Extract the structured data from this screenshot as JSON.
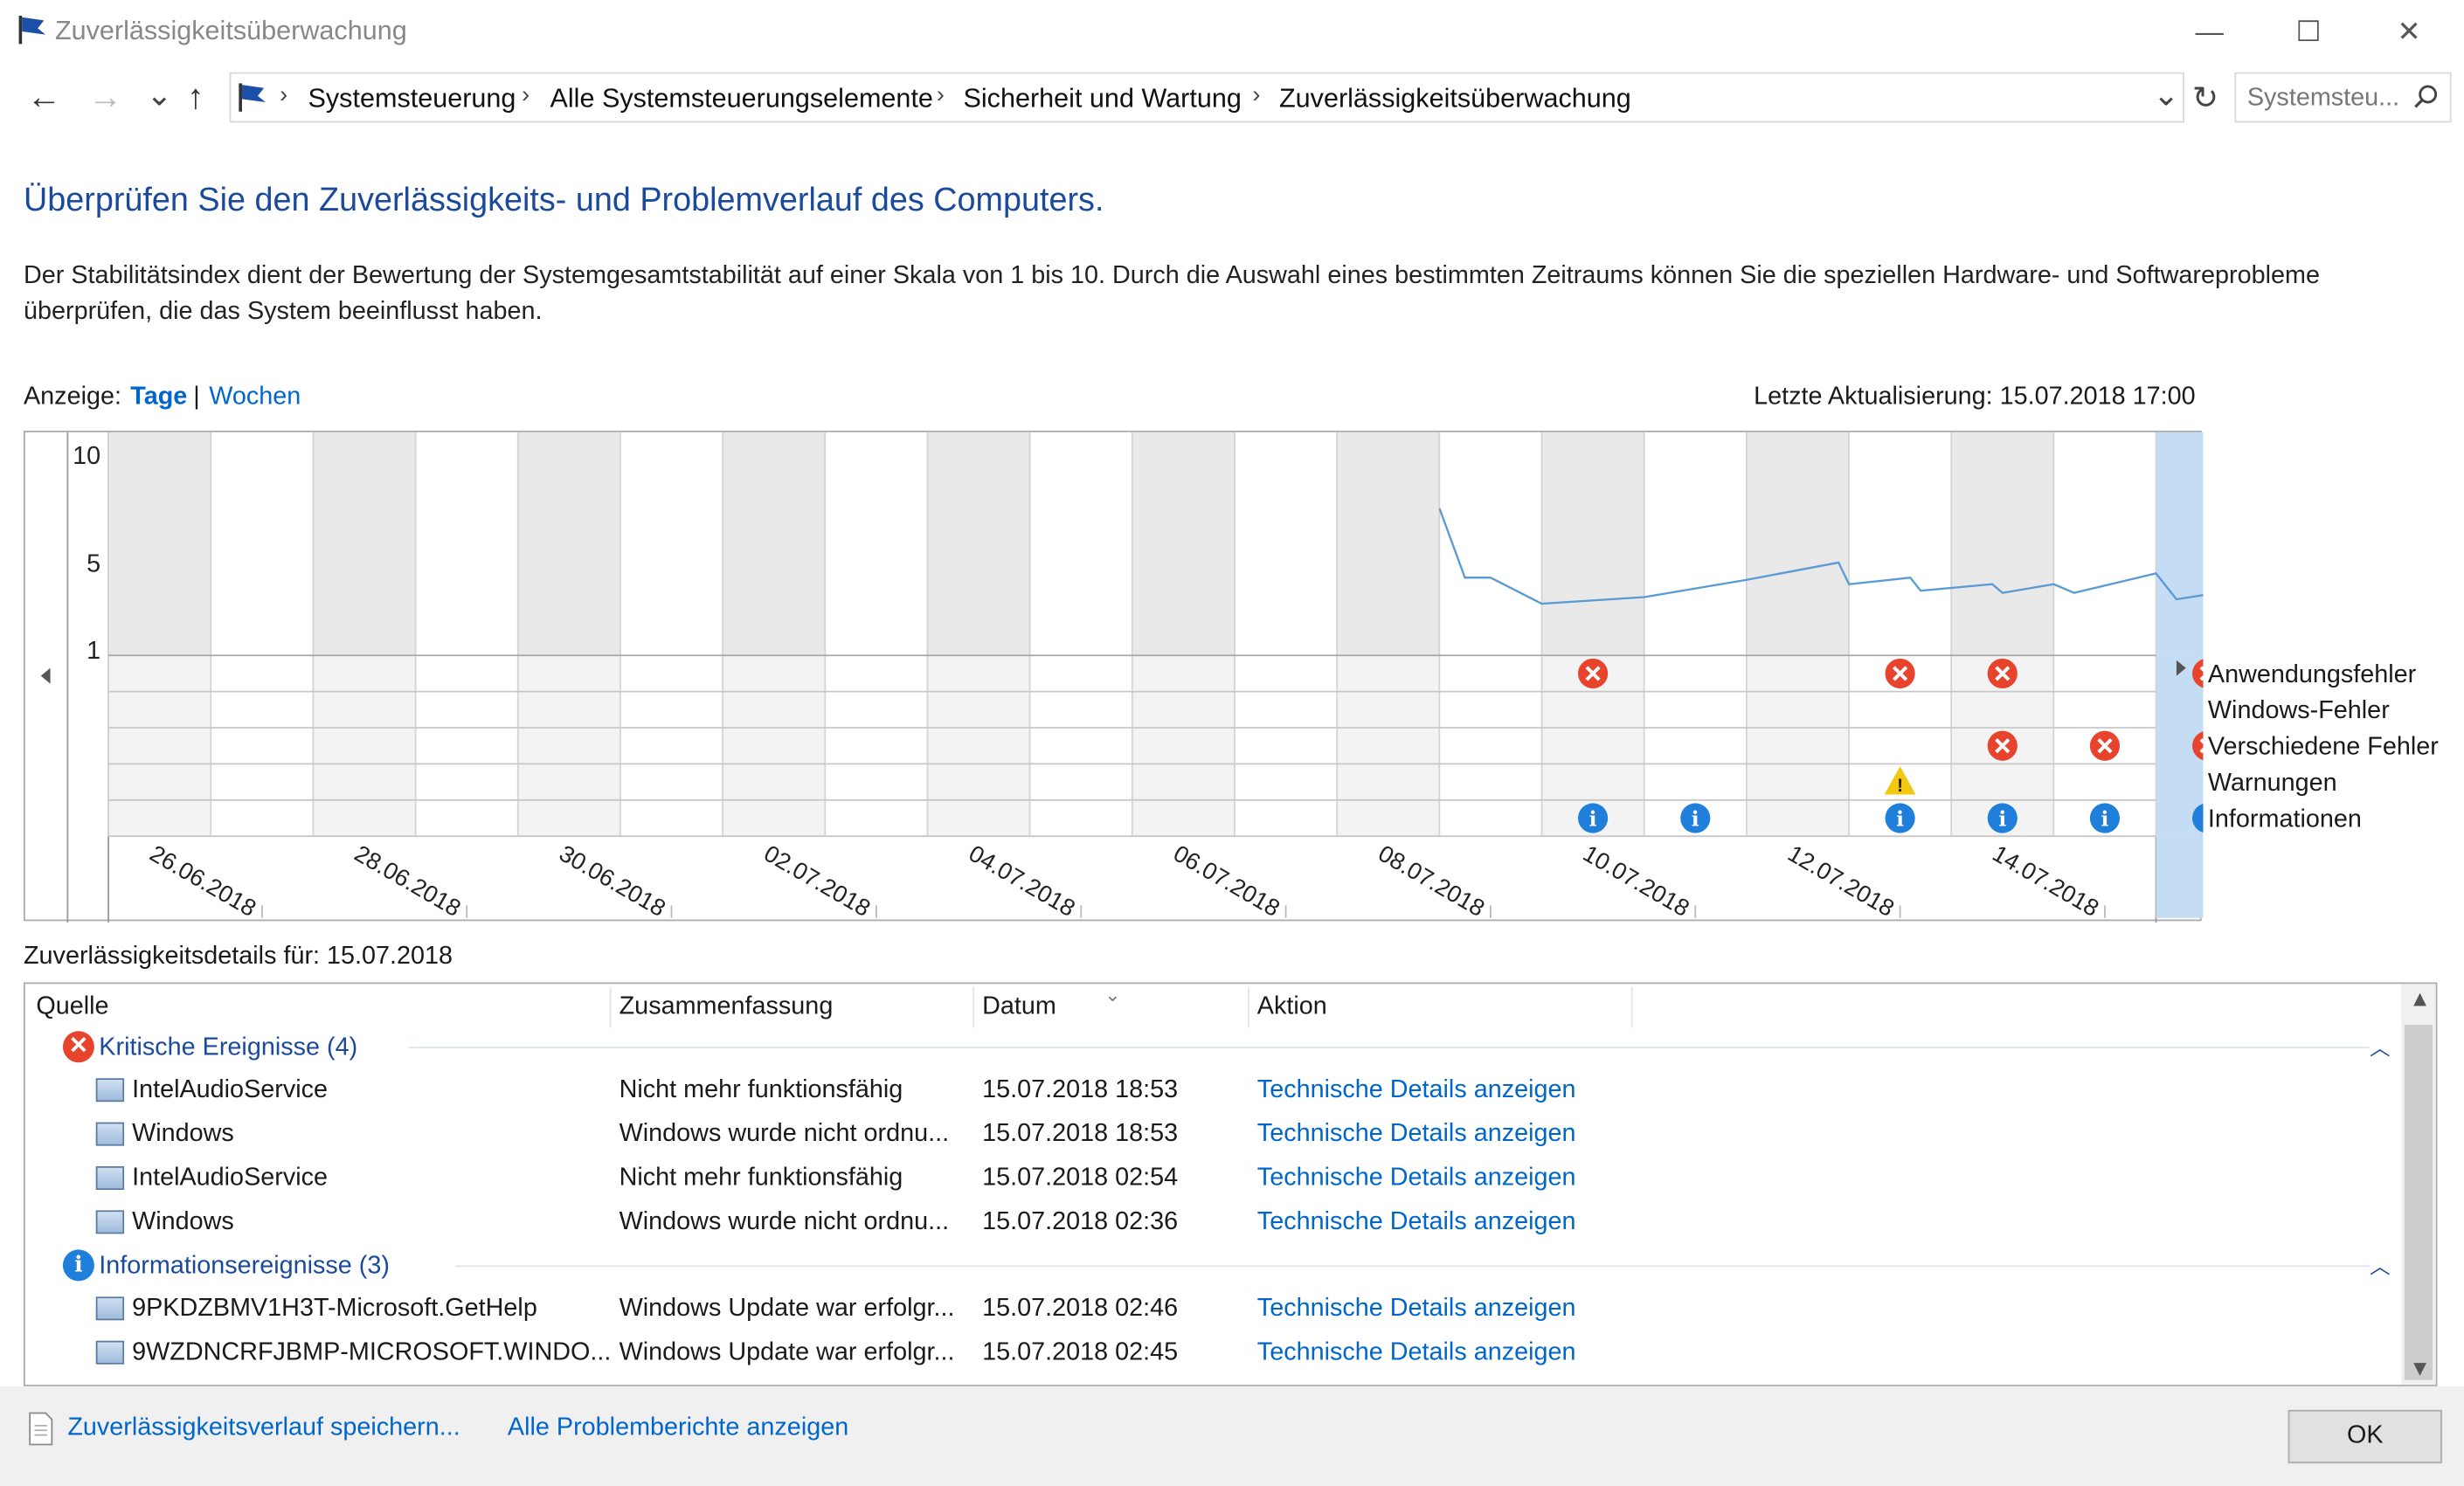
{
  "window": {
    "title": "Zuverlässigkeitsüberwachung",
    "minimize": "—",
    "maximize": "☐",
    "close": "✕"
  },
  "nav": {
    "back": "←",
    "forward": "→",
    "recent": "⌄",
    "up": "↑",
    "refresh": "↻",
    "dropdown": "⌄"
  },
  "breadcrumb": [
    "Systemsteuerung",
    "Alle Systemsteuerungselemente",
    "Sicherheit und Wartung",
    "Zuverlässigkeitsüberwachung"
  ],
  "search": {
    "placeholder": "Systemsteu...",
    "icon": "search-icon"
  },
  "heading": "Überprüfen Sie den Zuverlässigkeits- und Problemverlauf des Computers.",
  "description": "Der Stabilitätsindex dient der Bewertung der Systemgesamtstabilität auf einer Skala von 1 bis 10. Durch die Auswahl eines bestimmten Zeitraums können Sie die speziellen Hardware- und Softwareprobleme überprüfen, die das System beeinflusst haben.",
  "view": {
    "label": "Anzeige:",
    "days": "Tage",
    "sep": "|",
    "weeks": "Wochen"
  },
  "last_update": "Letzte Aktualisierung: 15.07.2018 17:00",
  "chart_data": {
    "type": "line",
    "title": "",
    "y_ticks": [
      "10",
      "5",
      "1"
    ],
    "ylim": [
      1,
      10
    ],
    "x_dates": [
      "26.06.2018",
      "28.06.2018",
      "30.06.2018",
      "02.07.2018",
      "04.07.2018",
      "06.07.2018",
      "08.07.2018",
      "10.07.2018",
      "12.07.2018",
      "14.07.2018"
    ],
    "days": [
      "25.06",
      "26.06",
      "27.06",
      "28.06",
      "29.06",
      "30.06",
      "01.07",
      "02.07",
      "03.07",
      "04.07",
      "05.07",
      "06.07",
      "07.07",
      "08.07",
      "09.07",
      "10.07",
      "11.07",
      "12.07",
      "13.07",
      "14.07",
      "15.07"
    ],
    "selected_day": "15.07",
    "stability_series": {
      "name": "",
      "x": [
        13.0,
        13.25,
        13.5,
        14.0,
        15.0,
        16.0,
        16.9,
        17.0,
        17.6,
        17.7,
        18.4,
        18.5,
        19.0,
        19.2,
        20.0,
        20.2,
        21.0
      ],
      "y": [
        7.5,
        4.3,
        4.3,
        3.1,
        3.4,
        4.2,
        5.0,
        4.0,
        4.3,
        3.7,
        4.0,
        3.6,
        4.0,
        3.6,
        4.5,
        3.3,
        3.9
      ]
    },
    "event_rows": [
      "Anwendungsfehler",
      "Windows-Fehler",
      "Verschiedene Fehler",
      "Warnungen",
      "Informationen"
    ],
    "events": [
      {
        "row": 0,
        "day": 14,
        "kind": "error"
      },
      {
        "row": 0,
        "day": 17,
        "kind": "error"
      },
      {
        "row": 0,
        "day": 18,
        "kind": "error"
      },
      {
        "row": 0,
        "day": 20,
        "kind": "error"
      },
      {
        "row": 2,
        "day": 18,
        "kind": "error"
      },
      {
        "row": 2,
        "day": 19,
        "kind": "error"
      },
      {
        "row": 2,
        "day": 20,
        "kind": "error"
      },
      {
        "row": 3,
        "day": 17,
        "kind": "warning"
      },
      {
        "row": 4,
        "day": 14,
        "kind": "info"
      },
      {
        "row": 4,
        "day": 15,
        "kind": "info"
      },
      {
        "row": 4,
        "day": 17,
        "kind": "info"
      },
      {
        "row": 4,
        "day": 18,
        "kind": "info"
      },
      {
        "row": 4,
        "day": 19,
        "kind": "info"
      },
      {
        "row": 4,
        "day": 20,
        "kind": "info"
      }
    ],
    "colors": {
      "line": "#5b9bd5",
      "weekend": "#e9e9e9",
      "selected": "#c5ddf4",
      "error": "#e8432c",
      "warning": "#f2c811",
      "info": "#1f7fdb"
    }
  },
  "details_label": "Zuverlässigkeitsdetails für: 15.07.2018",
  "columns": [
    "Quelle",
    "Zusammenfassung",
    "Datum",
    "Aktion"
  ],
  "groups": [
    {
      "title": "Kritische Ereignisse (4)",
      "icon": "error-icon",
      "rows": [
        {
          "source": "IntelAudioService",
          "summary": "Nicht mehr funktionsfähig",
          "date": "15.07.2018 18:53",
          "action": "Technische Details anzeigen"
        },
        {
          "source": "Windows",
          "summary": "Windows wurde nicht ordnu...",
          "date": "15.07.2018 18:53",
          "action": "Technische Details anzeigen"
        },
        {
          "source": "IntelAudioService",
          "summary": "Nicht mehr funktionsfähig",
          "date": "15.07.2018 02:54",
          "action": "Technische Details anzeigen"
        },
        {
          "source": "Windows",
          "summary": "Windows wurde nicht ordnu...",
          "date": "15.07.2018 02:36",
          "action": "Technische Details anzeigen"
        }
      ]
    },
    {
      "title": "Informationsereignisse (3)",
      "icon": "info-icon",
      "rows": [
        {
          "source": "9PKDZBMV1H3T-Microsoft.GetHelp",
          "summary": "Windows Update war erfolgr...",
          "date": "15.07.2018 02:46",
          "action": "Technische Details anzeigen"
        },
        {
          "source": "9WZDNCRFJBMP-MICROSOFT.WINDO...",
          "summary": "Windows Update war erfolgr...",
          "date": "15.07.2018 02:45",
          "action": "Technische Details anzeigen"
        }
      ]
    }
  ],
  "footer": {
    "save": "Zuverlässigkeitsverlauf speichern...",
    "all_reports": "Alle Problemberichte anzeigen",
    "ok": "OK"
  }
}
